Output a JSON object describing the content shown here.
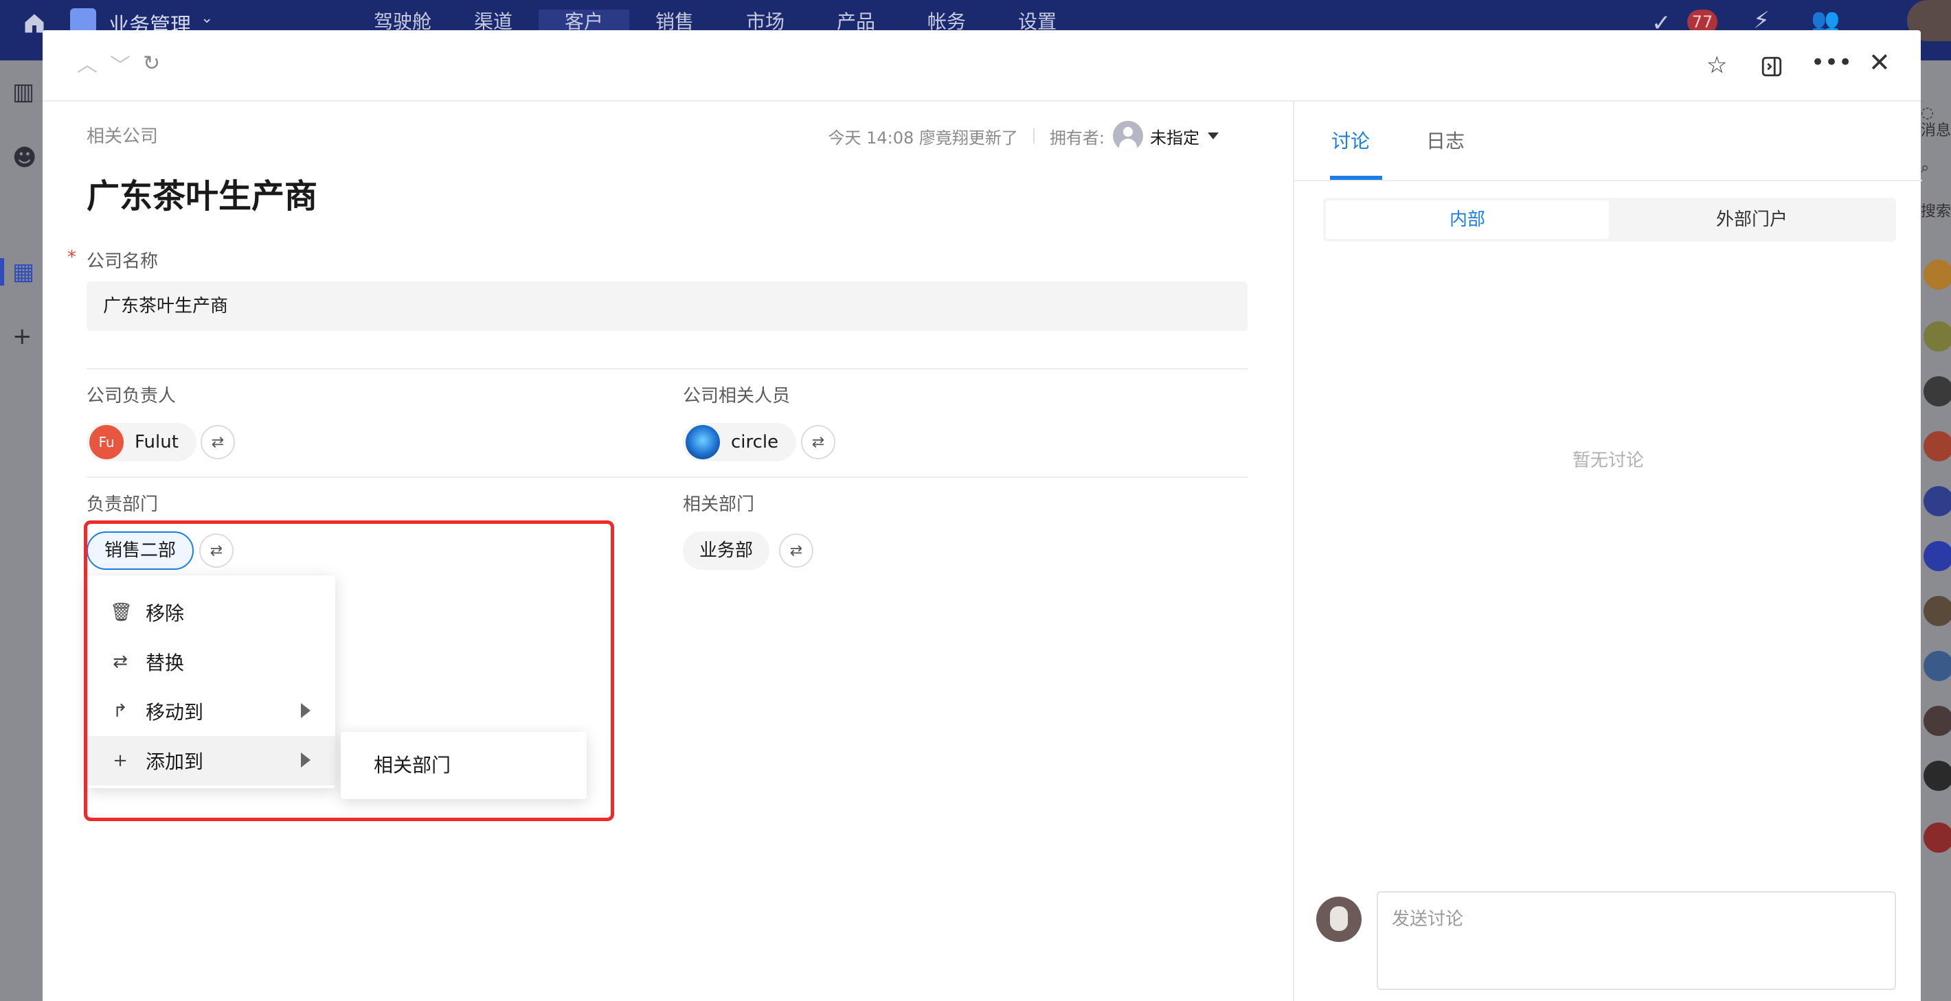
{
  "topbar": {
    "app_name": "业务管理",
    "nav": [
      "驾驶舱",
      "渠道",
      "客户",
      "销售",
      "市场",
      "产品",
      "帐务",
      "设置"
    ],
    "active_nav": "客户",
    "notification_count": "77"
  },
  "rightstrip": {
    "message_label": "消息",
    "search_label": "搜索"
  },
  "modal": {
    "breadcrumb": "相关公司",
    "meta": {
      "updated": "今天 14:08 廖竟翔更新了",
      "owner_label": "拥有者:",
      "owner_name": "未指定"
    },
    "title": "广东茶叶生产商",
    "fields": {
      "company_name": {
        "label": "公司名称",
        "value": "广东茶叶生产商"
      },
      "company_owner": {
        "label": "公司负责人",
        "user_name": "Fulut",
        "avatar_text": "Fu"
      },
      "company_related": {
        "label": "公司相关人员",
        "user_name": "circle"
      },
      "responsible_dept": {
        "label": "负责部门",
        "value": "销售二部"
      },
      "related_dept": {
        "label": "相关部门",
        "value": "业务部"
      }
    },
    "context_menu": {
      "items": [
        {
          "label": "移除",
          "icon": "trash-icon"
        },
        {
          "label": "替换",
          "icon": "swap-icon"
        },
        {
          "label": "移动到",
          "icon": "move-arrow-icon",
          "has_submenu": true
        },
        {
          "label": "添加到",
          "icon": "plus-icon",
          "has_submenu": true
        }
      ],
      "submenu_items": [
        "相关部门"
      ]
    }
  },
  "side_panel": {
    "tabs": [
      "讨论",
      "日志"
    ],
    "active_tab": "讨论",
    "segments": [
      "内部",
      "外部门户"
    ],
    "active_segment": "内部",
    "empty_text": "暂无讨论",
    "compose_placeholder": "发送讨论"
  },
  "colors": {
    "accent": "#1a7ee6",
    "highlight_border": "#ee2a2a",
    "required_mark": "#e24b3a",
    "owner_avatar": "#e8563f",
    "topbar": "#1b2a6e"
  }
}
